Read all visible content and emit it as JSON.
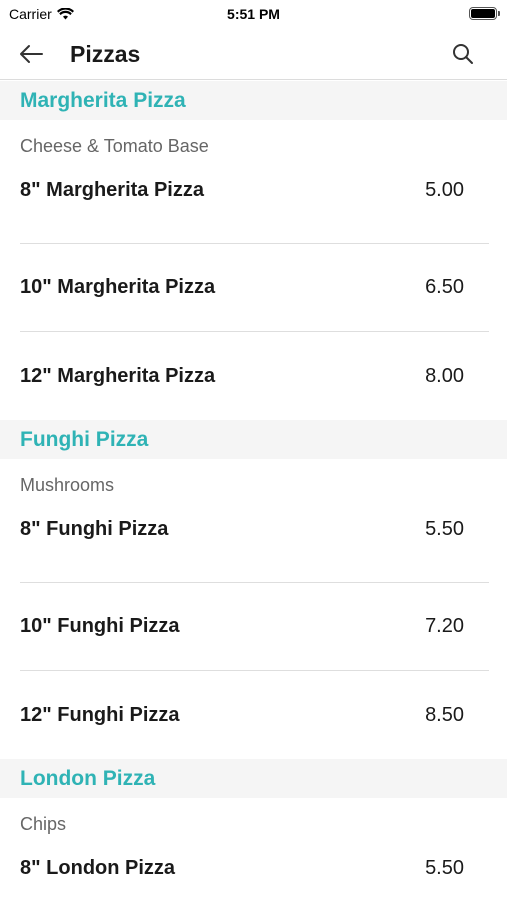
{
  "status_bar": {
    "carrier": "Carrier",
    "time": "5:51 PM"
  },
  "nav": {
    "title": "Pizzas",
    "back_icon": "arrow-left-icon",
    "search_icon": "search-icon"
  },
  "colors": {
    "accent": "#2fb3b5",
    "section_bg": "#f5f5f5",
    "divider": "#dedede"
  },
  "sections": [
    {
      "title": "Margherita Pizza",
      "description": "Cheese & Tomato Base",
      "items": [
        {
          "name": "8\" Margherita Pizza",
          "price": "5.00"
        },
        {
          "name": "10\" Margherita Pizza",
          "price": "6.50"
        },
        {
          "name": "12\" Margherita Pizza",
          "price": "8.00"
        }
      ]
    },
    {
      "title": "Funghi Pizza",
      "description": "Mushrooms",
      "items": [
        {
          "name": "8\" Funghi Pizza",
          "price": "5.50"
        },
        {
          "name": "10\" Funghi Pizza",
          "price": "7.20"
        },
        {
          "name": "12\" Funghi Pizza",
          "price": "8.50"
        }
      ]
    },
    {
      "title": "London Pizza",
      "description": "Chips",
      "items": [
        {
          "name": "8\" London Pizza",
          "price": "5.50"
        }
      ]
    }
  ]
}
